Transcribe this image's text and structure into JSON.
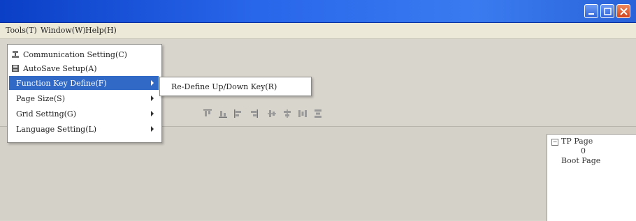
{
  "window": {
    "buttons": [
      {
        "name": "minimize",
        "icon": "minimize-icon"
      },
      {
        "name": "maximize",
        "icon": "maximize-icon"
      },
      {
        "name": "close",
        "icon": "close-icon"
      }
    ]
  },
  "menubar": {
    "items": [
      {
        "label": "Tools(T)"
      },
      {
        "label": "Window(W)"
      },
      {
        "label": "Help(H)"
      }
    ]
  },
  "tools_menu": {
    "items": [
      {
        "label": "Communication Setting(C)",
        "icon": "communication-icon"
      },
      {
        "label": "AutoSave Setup(A)",
        "icon": "autosave-icon"
      },
      {
        "label": "Function Key Define(F)",
        "active": true,
        "has_submenu": true
      },
      {
        "label": "Page Size(S)",
        "has_submenu": true
      },
      {
        "label": "Grid Setting(G)",
        "has_submenu": true
      },
      {
        "label": "Language Setting(L)",
        "has_submenu": true
      }
    ]
  },
  "submenu": {
    "items": [
      {
        "label": "Re-Define Up/Down Key(R)"
      }
    ]
  },
  "toolbar": {
    "icons": [
      "align-top-icon",
      "align-bottom-icon",
      "align-left-icon",
      "align-right-icon",
      "align-vcenter-icon",
      "align-hcenter-icon",
      "distribute-h-icon",
      "distribute-v-icon"
    ]
  },
  "project_tree": {
    "root": "TP Page",
    "child": "0",
    "sibling": "Boot Page"
  },
  "colors": {
    "titlebar": "#2866ea",
    "menu_highlight": "#3169c6",
    "menubar": "#ece9d8"
  }
}
